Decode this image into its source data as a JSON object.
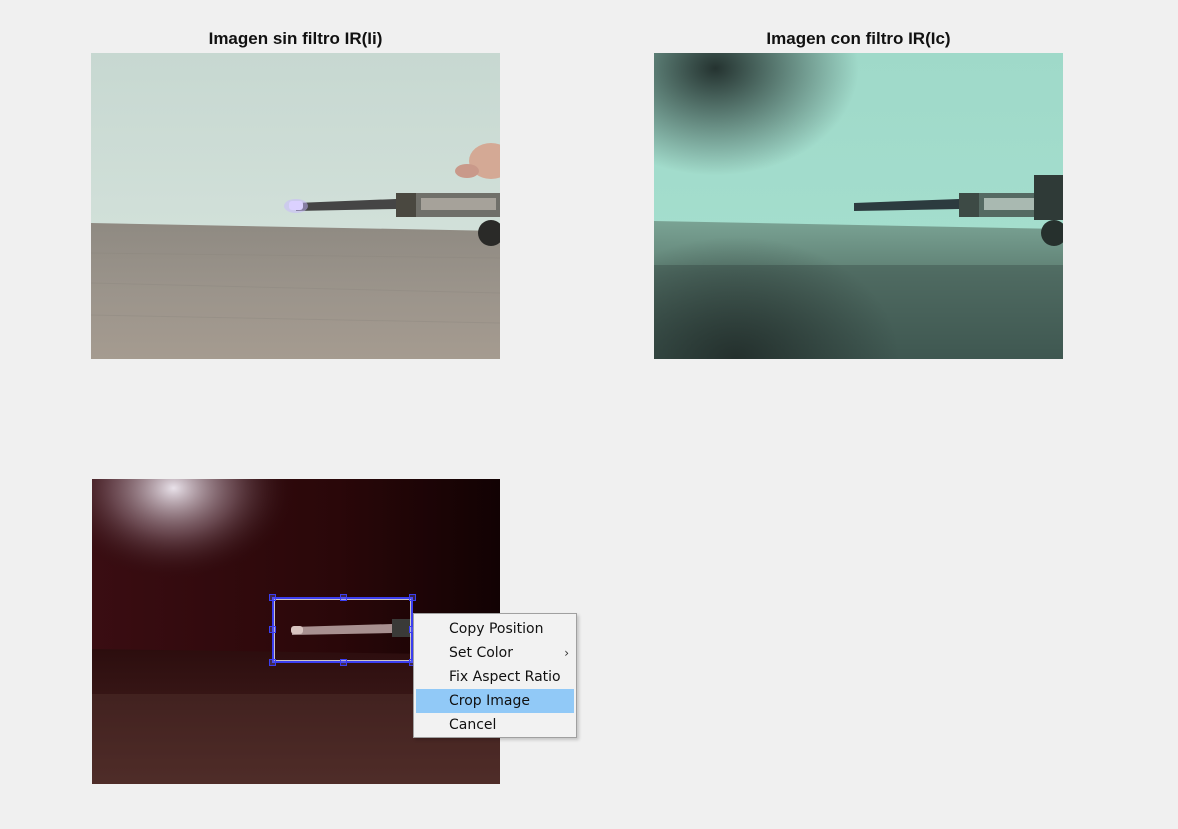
{
  "figure": {
    "axes1_title": "Imagen sin filtro IR(Ii)",
    "axes2_title": "Imagen con filtro IR(Ic)",
    "axes3_title": ""
  },
  "roi": {
    "stroke_color": "#3b3ef0"
  },
  "context_menu": {
    "items": [
      {
        "label": "Copy Position",
        "submenu": false,
        "highlighted": false
      },
      {
        "label": "Set Color",
        "submenu": true,
        "highlighted": false
      },
      {
        "label": "Fix Aspect Ratio",
        "submenu": false,
        "highlighted": false
      },
      {
        "label": "Crop Image",
        "submenu": false,
        "highlighted": true
      },
      {
        "label": "Cancel",
        "submenu": false,
        "highlighted": false
      }
    ],
    "highlight_color": "#91c9f7",
    "submenu_arrow": "›"
  }
}
